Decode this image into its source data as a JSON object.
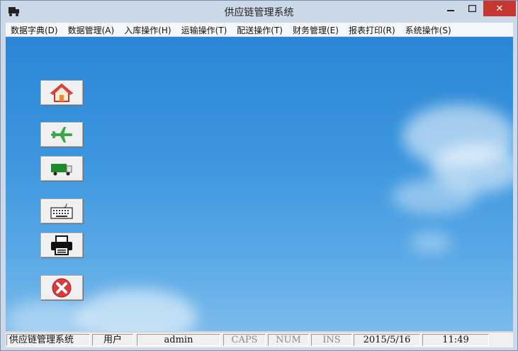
{
  "window": {
    "title": "供应链管理系统",
    "close_glyph": "✕"
  },
  "menu": [
    "数据字典(D)",
    "数据管理(A)",
    "入库操作(H)",
    "运输操作(T)",
    "配送操作(T)",
    "财务管理(E)",
    "报表打印(R)",
    "系统操作(S)"
  ],
  "toolbar": [
    {
      "name": "home-button",
      "icon": "house-icon"
    },
    {
      "name": "flight-button",
      "icon": "airplane-icon"
    },
    {
      "name": "truck-button",
      "icon": "truck-icon"
    },
    {
      "name": "keyboard-button",
      "icon": "keyboard-icon"
    },
    {
      "name": "print-button",
      "icon": "printer-icon"
    },
    {
      "name": "exit-button",
      "icon": "close-circle-icon"
    }
  ],
  "status": {
    "app": "供应链管理系统",
    "user_label": "用户",
    "user": "admin",
    "caps": "CAPS",
    "num": "NUM",
    "ins": "INS",
    "date": "2015/5/16",
    "time": "11:49"
  },
  "colors": {
    "sky": "#3b95de",
    "close": "#c7372f",
    "exit": "#d93a3a",
    "plane": "#3aa84a",
    "truck": "#1f8a2a"
  }
}
